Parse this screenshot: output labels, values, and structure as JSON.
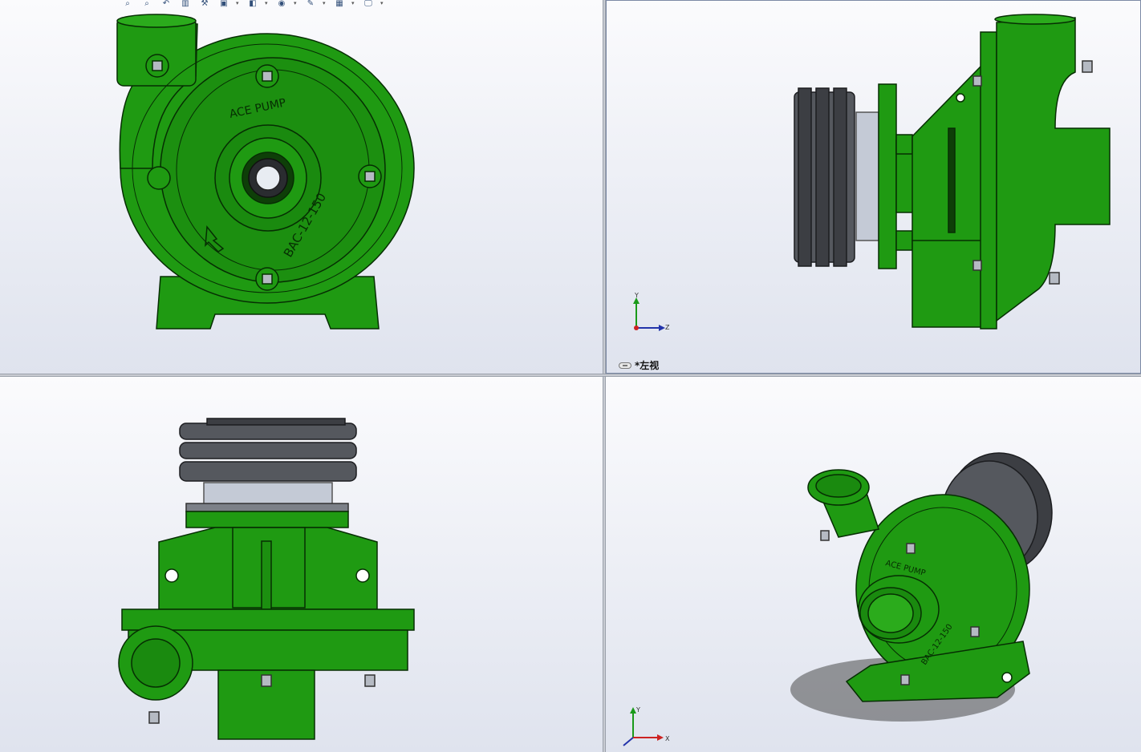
{
  "toolbar": {
    "buttons": [
      {
        "name": "zoom-to-fit-icon",
        "glyph": "⌕"
      },
      {
        "name": "zoom-area-icon",
        "glyph": "⌕"
      },
      {
        "name": "previous-view-icon",
        "glyph": "↶"
      },
      {
        "name": "section-view-icon",
        "glyph": "▥"
      },
      {
        "name": "dynamic-annotation-icon",
        "glyph": "⚒"
      },
      {
        "name": "view-orientation-icon",
        "glyph": "▣"
      },
      {
        "name": "display-style-icon",
        "glyph": "◧"
      },
      {
        "name": "hide-show-items-icon",
        "glyph": "◉"
      },
      {
        "name": "edit-appearance-icon",
        "glyph": "✎"
      },
      {
        "name": "apply-scene-icon",
        "glyph": "▦"
      },
      {
        "name": "view-settings-icon",
        "glyph": "🖵"
      }
    ]
  },
  "views": {
    "front": {
      "text_top": "ACE PUMP",
      "text_model": "BAC-12-150"
    },
    "left": {
      "label": "*左视",
      "axis_y": "Y",
      "axis_z": "Z"
    },
    "top": {},
    "iso": {
      "text_top": "ACE PUMP",
      "text_model": "BAC-12-150",
      "axis_y": "Y",
      "axis_x": "X"
    }
  },
  "colors": {
    "body_green": "#1f9a12",
    "dark_green": "#0d5f07",
    "outline": "#062e03",
    "pulley": "#55585e",
    "steel": "#c4cad6"
  }
}
